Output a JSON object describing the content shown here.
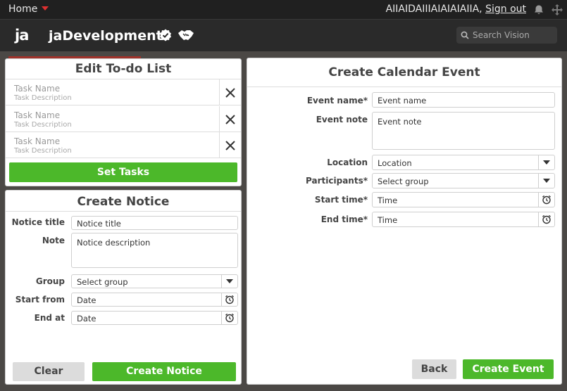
{
  "topbar": {
    "home_label": "Home",
    "user_text": "AIIAIDAIIIAIAIAIAIIA,",
    "signout_label": "Sign out"
  },
  "appbar": {
    "logo_text": "ja",
    "app_name": "jaDevelopment",
    "search_placeholder": "Search Vision"
  },
  "todo": {
    "title": "Edit To-do List",
    "tasks": [
      {
        "name": "Task Name",
        "description": "Task Description"
      },
      {
        "name": "Task Name",
        "description": "Task Description"
      },
      {
        "name": "Task Name",
        "description": "Task Description"
      }
    ],
    "set_button": "Set Tasks"
  },
  "notice": {
    "title": "Create Notice",
    "fields": {
      "title_label": "Notice title",
      "title_placeholder": "Notice title",
      "note_label": "Note",
      "note_placeholder": "Notice description",
      "group_label": "Group",
      "group_value": "Select group",
      "start_label": "Start from",
      "start_placeholder": "Date",
      "end_label": "End at",
      "end_placeholder": "Date"
    },
    "clear_button": "Clear",
    "create_button": "Create Notice"
  },
  "event": {
    "title": "Create Calendar Event",
    "fields": {
      "name_label": "Event name*",
      "name_placeholder": "Event name",
      "note_label": "Event note",
      "note_placeholder": "Event note",
      "location_label": "Location",
      "location_value": "Location",
      "participants_label": "Participants*",
      "participants_value": "Select group",
      "start_label": "Start time*",
      "start_placeholder": "Time",
      "end_label": "End time*",
      "end_placeholder": "Time"
    },
    "back_button": "Back",
    "create_button": "Create Event"
  },
  "colors": {
    "accent_green": "#4cb82a",
    "topbar_bg": "#202020",
    "appbar_bg": "#2a2a2a",
    "caret_red": "#e03030"
  }
}
